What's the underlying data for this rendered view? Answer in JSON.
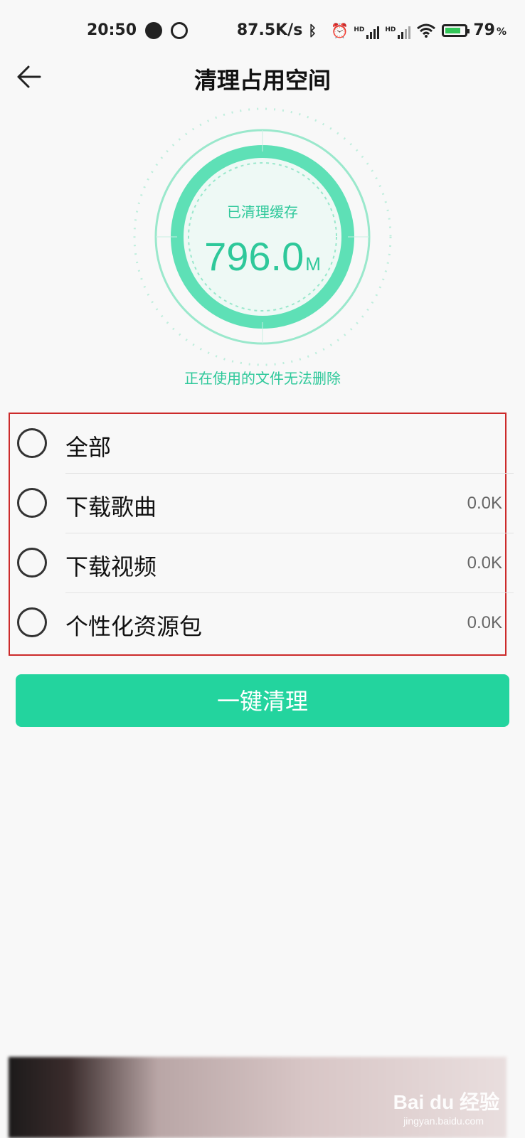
{
  "status_bar": {
    "time": "20:50",
    "net_speed": "87.5K/s",
    "hd1": "HD",
    "hd2": "HD",
    "battery_pct": "79",
    "pct_sign": "%"
  },
  "header": {
    "title": "清理占用空间"
  },
  "gauge": {
    "caption": "已清理缓存",
    "value": "796.0",
    "unit": "M"
  },
  "note": "正在使用的文件无法删除",
  "list": {
    "items": [
      {
        "label": "全部",
        "size": ""
      },
      {
        "label": "下载歌曲",
        "size": "0.0K"
      },
      {
        "label": "下载视频",
        "size": "0.0K"
      },
      {
        "label": "个性化资源包",
        "size": "0.0K"
      }
    ]
  },
  "actions": {
    "clean_label": "一键清理"
  },
  "watermark": {
    "brand": "Bai du 经验",
    "url": "jingyan.baidu.com"
  },
  "colors": {
    "accent": "#23d49e",
    "gauge_ring": "#5ee0b6",
    "highlight_border": "#cc2a2a"
  }
}
